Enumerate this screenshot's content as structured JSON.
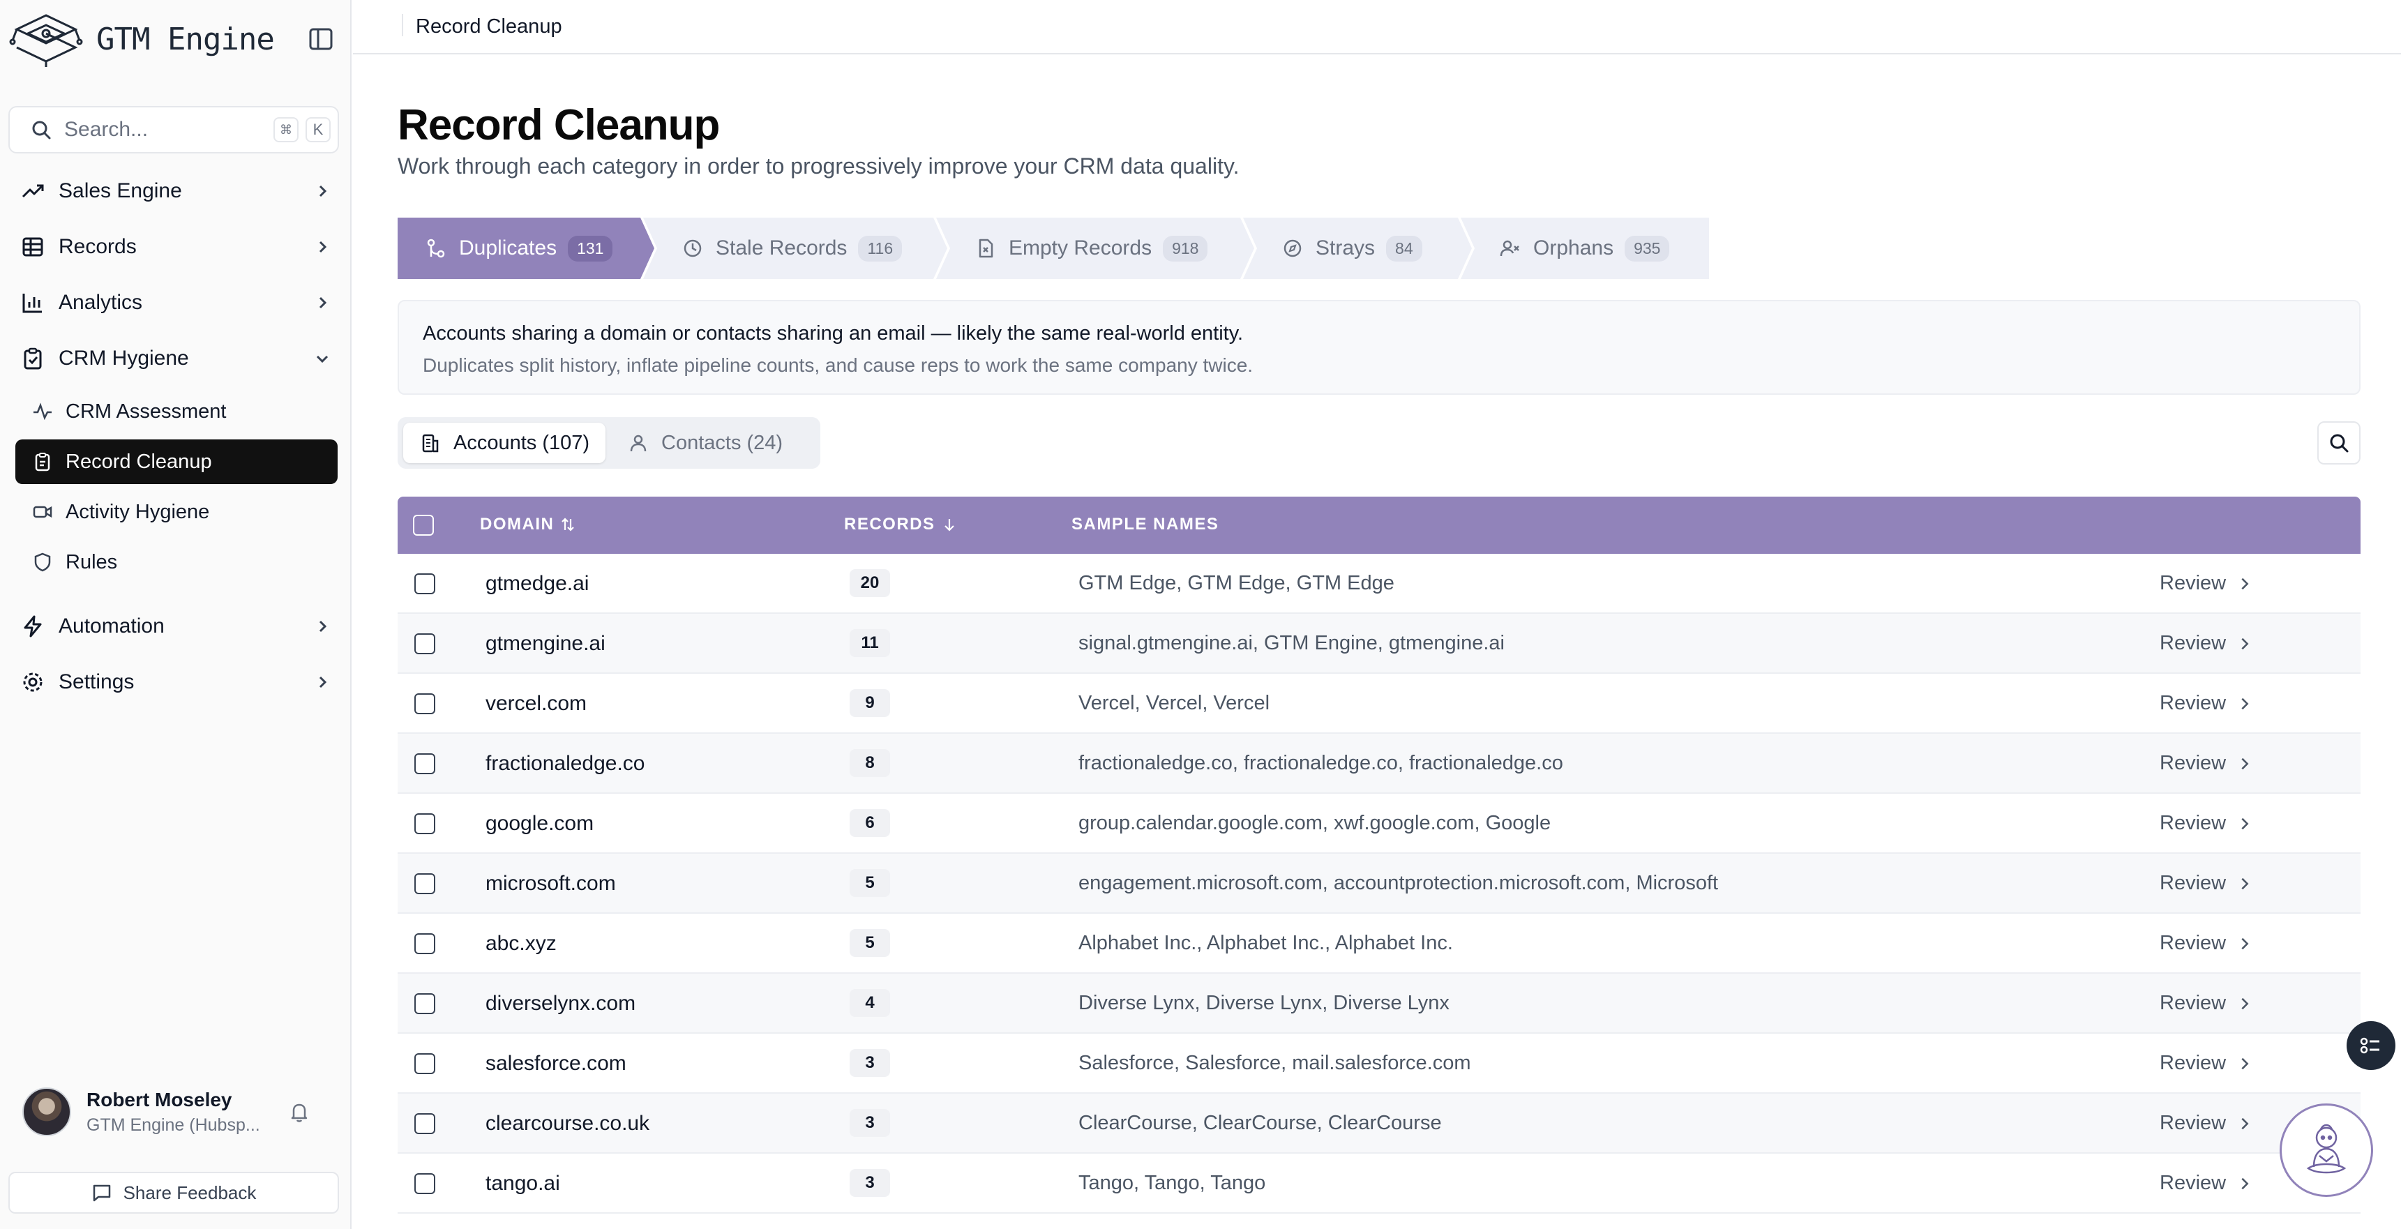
{
  "brand": {
    "name": "GTM Engine"
  },
  "search": {
    "placeholder": "Search...",
    "kbd_cmd": "⌘",
    "kbd_key": "K"
  },
  "nav": {
    "sales_engine": "Sales Engine",
    "records": "Records",
    "analytics": "Analytics",
    "crm_hygiene": "CRM Hygiene",
    "crm_assessment": "CRM Assessment",
    "record_cleanup": "Record Cleanup",
    "activity_hygiene": "Activity Hygiene",
    "rules": "Rules",
    "automation": "Automation",
    "settings": "Settings"
  },
  "user": {
    "name": "Robert Moseley",
    "org": "GTM Engine (Hubsp..."
  },
  "feedback": {
    "label": "Share Feedback"
  },
  "breadcrumb": {
    "current": "Record Cleanup"
  },
  "page": {
    "title": "Record Cleanup",
    "subtitle": "Work through each category in order to progressively improve your CRM data quality."
  },
  "steps": [
    {
      "label": "Duplicates",
      "count": "131"
    },
    {
      "label": "Stale Records",
      "count": "116"
    },
    {
      "label": "Empty Records",
      "count": "918"
    },
    {
      "label": "Strays",
      "count": "84"
    },
    {
      "label": "Orphans",
      "count": "935"
    }
  ],
  "info": {
    "line1": "Accounts sharing a domain or contacts sharing an email — likely the same real-world entity.",
    "line2": "Duplicates split history, inflate pipeline counts, and cause reps to work the same company twice."
  },
  "subtabs": [
    {
      "label": "Accounts (107)"
    },
    {
      "label": "Contacts (24)"
    }
  ],
  "table": {
    "headers": {
      "domain": "DOMAIN",
      "records": "RECORDS",
      "sample_names": "SAMPLE NAMES"
    },
    "review_label": "Review",
    "rows": [
      {
        "domain": "gtmedge.ai",
        "records": "20",
        "names": "GTM Edge, GTM Edge, GTM Edge"
      },
      {
        "domain": "gtmengine.ai",
        "records": "11",
        "names": "signal.gtmengine.ai, GTM Engine, gtmengine.ai"
      },
      {
        "domain": "vercel.com",
        "records": "9",
        "names": "Vercel, Vercel, Vercel"
      },
      {
        "domain": "fractionaledge.co",
        "records": "8",
        "names": "fractionaledge.co, fractionaledge.co, fractionaledge.co"
      },
      {
        "domain": "google.com",
        "records": "6",
        "names": "group.calendar.google.com, xwf.google.com, Google"
      },
      {
        "domain": "microsoft.com",
        "records": "5",
        "names": "engagement.microsoft.com, accountprotection.microsoft.com, Microsoft"
      },
      {
        "domain": "abc.xyz",
        "records": "5",
        "names": "Alphabet Inc., Alphabet Inc., Alphabet Inc."
      },
      {
        "domain": "diverselynx.com",
        "records": "4",
        "names": "Diverse Lynx, Diverse Lynx, Diverse Lynx"
      },
      {
        "domain": "salesforce.com",
        "records": "3",
        "names": "Salesforce, Salesforce, mail.salesforce.com"
      },
      {
        "domain": "clearcourse.co.uk",
        "records": "3",
        "names": "ClearCourse, ClearCourse, ClearCourse"
      },
      {
        "domain": "tango.ai",
        "records": "3",
        "names": "Tango, Tango, Tango"
      }
    ]
  },
  "colors": {
    "accent": "#9183ba",
    "active_nav": "#111111"
  },
  "icons": [
    "brain-circuit-icon",
    "sidebar-toggle-icon",
    "search-icon",
    "trending-up-icon",
    "grid-icon",
    "bar-chart-icon",
    "clipboard-check-icon",
    "activity-icon",
    "clipboard-icon",
    "video-icon",
    "shield-icon",
    "zap-icon",
    "gear-icon",
    "bell-icon",
    "message-square-icon",
    "git-merge-icon",
    "clock-icon",
    "file-x-icon",
    "compass-icon",
    "user-x-icon",
    "building-icon",
    "user-icon",
    "chevron-right-icon",
    "chevron-down-icon",
    "sort-icon",
    "list-icon",
    "assistant-bot-icon"
  ]
}
